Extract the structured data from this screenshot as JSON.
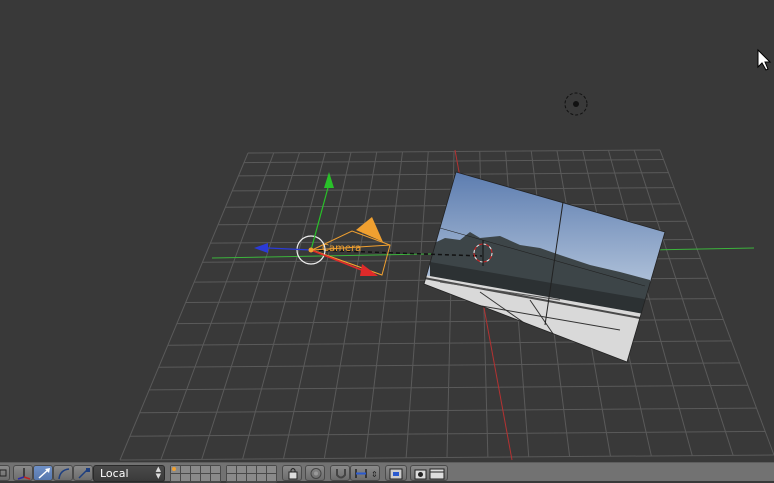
{
  "viewport": {
    "object_label": "Camera",
    "grid_color": "#5a5a5a",
    "x_axis_color": "#c83232",
    "y_axis_color": "#3cb43c",
    "camera_color": "#f0a030"
  },
  "header": {
    "orientation_value": "Local",
    "icons": [
      "view-menu-icon",
      "manipulator-toggle-icon",
      "translate-icon",
      "rotate-icon",
      "scale-icon",
      "layers-icon",
      "lock-icon",
      "proportional-edit-icon",
      "snap-magnet-icon",
      "snap-element-icon",
      "opengl-render-icon",
      "render-animation-icon"
    ]
  }
}
